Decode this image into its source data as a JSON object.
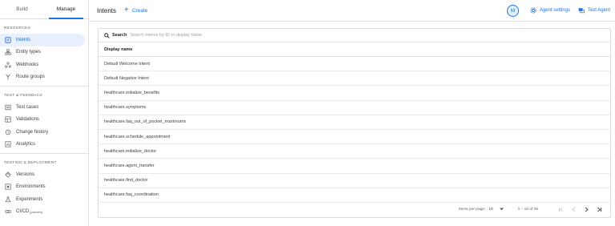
{
  "sidebar": {
    "tabs": [
      {
        "label": "Build",
        "active": false
      },
      {
        "label": "Manage",
        "active": true
      }
    ],
    "sections": [
      {
        "title": "RESOURCES",
        "items": [
          {
            "label": "Intents",
            "icon": "intents-icon",
            "active": true
          },
          {
            "label": "Entity types",
            "icon": "entity-types-icon",
            "active": false
          },
          {
            "label": "Webhooks",
            "icon": "webhooks-icon",
            "active": false
          },
          {
            "label": "Route groups",
            "icon": "route-groups-icon",
            "active": false
          }
        ]
      },
      {
        "title": "TEST & FEEDBACK",
        "items": [
          {
            "label": "Test cases",
            "icon": "test-cases-icon",
            "active": false
          },
          {
            "label": "Validations",
            "icon": "validations-icon",
            "active": false
          },
          {
            "label": "Change history",
            "icon": "history-icon",
            "active": false
          },
          {
            "label": "Analytics",
            "icon": "analytics-icon",
            "active": false
          }
        ]
      },
      {
        "title": "TESTING & DEPLOYMENT",
        "items": [
          {
            "label": "Versions",
            "icon": "versions-icon",
            "active": false
          },
          {
            "label": "Environments",
            "icon": "environments-icon",
            "active": false
          },
          {
            "label": "Experiments",
            "icon": "experiments-icon",
            "active": false
          },
          {
            "label": "CI/CD",
            "badge": "[preview]",
            "icon": "cicd-icon",
            "active": false
          }
        ]
      }
    ]
  },
  "topbar": {
    "title": "Intents",
    "create_label": "Create",
    "avatar_letter": "M",
    "agent_settings_label": "Agent settings",
    "test_agent_label": "Test Agent"
  },
  "table": {
    "search_label": "Search",
    "search_placeholder": "Search intents by ID or display name",
    "column_header": "Display name",
    "rows": [
      "Default Welcome Intent",
      "Default Negative Intent",
      "healthcare.initialize_benefits",
      "healthcare.symptoms",
      "healthcare.faq_out_of_pocket_maximums",
      "healthcare.schedule_appointment",
      "healthcare.initialize_doctor",
      "healthcare.agent_transfer",
      "healthcare.find_doctor",
      "healthcare.faq_coordination"
    ]
  },
  "pagination": {
    "items_per_page_label": "Items per page:",
    "items_per_page_value": "10",
    "range_label": "1 – 10 of 36"
  },
  "colors": {
    "accent": "#1a73e8",
    "active_bg": "#e8f0fe",
    "border": "#e0e0e0"
  }
}
